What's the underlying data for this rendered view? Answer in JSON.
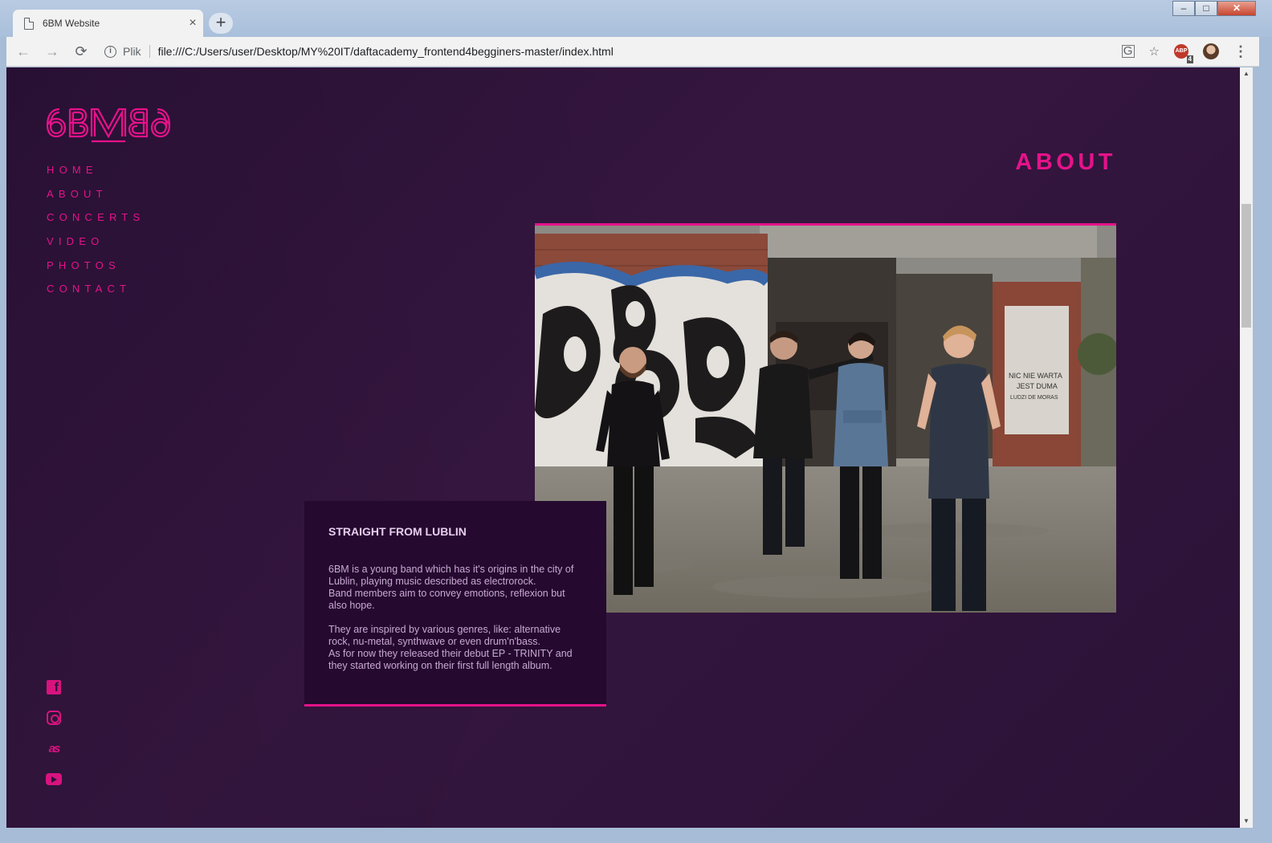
{
  "browser": {
    "tab_title": "6BM Website",
    "tab_close": "×",
    "new_tab": "+",
    "address_scheme_label": "Plik",
    "url": "file:///C:/Users/user/Desktop/MY%20IT/daftacademy_frontend4begginers-master/index.html",
    "adblock_badge": "4",
    "adblock_label": "ABP"
  },
  "site": {
    "logo_text": "6BM",
    "nav": [
      "HOME",
      "ABOUT",
      "CONCERTS",
      "VIDEO",
      "PHOTOS",
      "CONTACT"
    ],
    "section_title": "ABOUT",
    "box": {
      "heading": "STRAIGHT FROM LUBLIN",
      "p1": [
        "6BM is a young band which has it's origins in the city of",
        "Lublin, playing music described as electrorock.",
        "Band members aim to convey emotions, reflexion but",
        "also hope."
      ],
      "p2": [
        "They are inspired by various genres, like: alternative",
        "rock, nu-metal, synthwave or even drum'n'bass.",
        "As for now they released their debut EP - TRINITY and",
        "they started working on their first full length album."
      ]
    },
    "graffiti_text": [
      "NIC NIE WARTA",
      "JEST DUMA",
      "LUDZI DE MORAS"
    ],
    "social": [
      "facebook-icon",
      "instagram-icon",
      "lastfm-icon",
      "youtube-icon"
    ]
  },
  "colors": {
    "accent": "#e6128a",
    "page_bg": "#2d1338",
    "box_bg": "#25092f"
  }
}
